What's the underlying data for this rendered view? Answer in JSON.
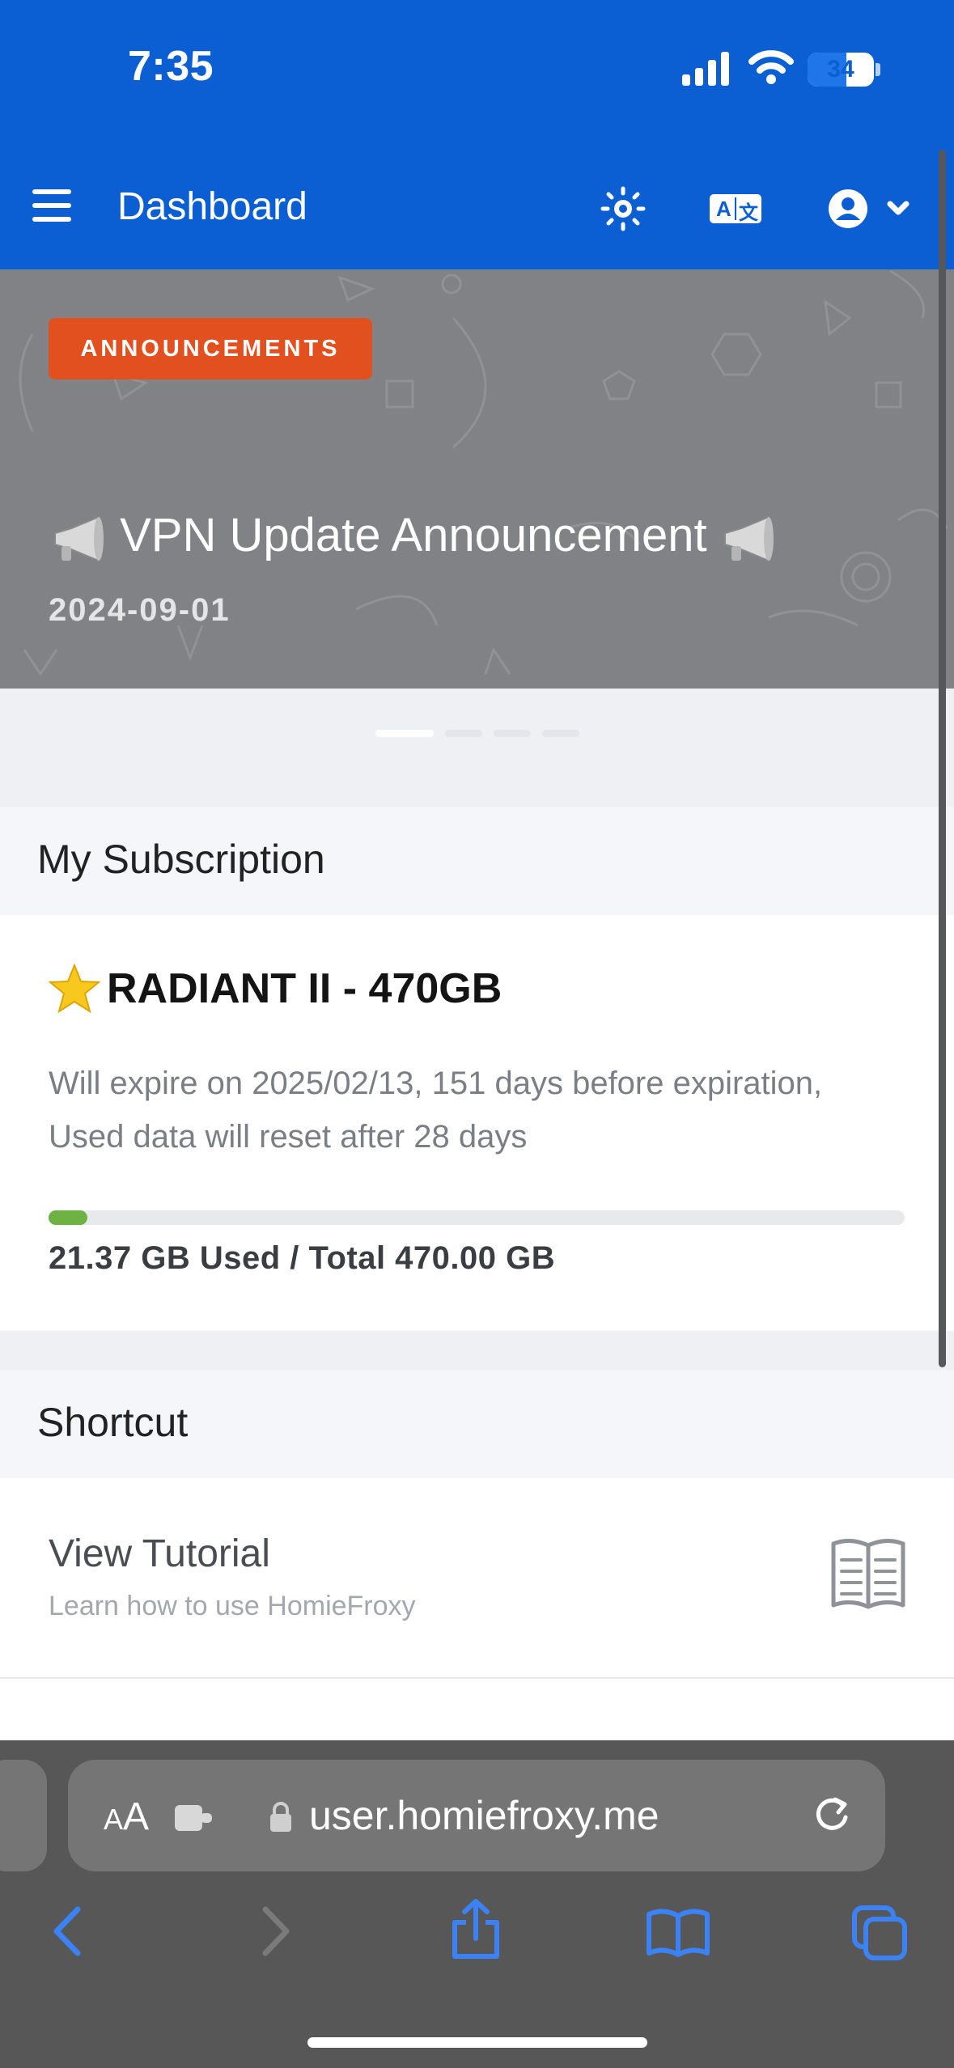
{
  "status_bar": {
    "time": "7:35",
    "battery": "34"
  },
  "header": {
    "title": "Dashboard",
    "lang_a": "A",
    "lang_b": "文"
  },
  "announcement": {
    "badge": "ANNOUNCEMENTS",
    "title": "VPN Update Announcement",
    "date": "2024-09-01",
    "slide_count": 4,
    "active_slide": 0
  },
  "subscription": {
    "heading": "My Subscription",
    "plan_name": "RADIANT II - 470GB",
    "description": "Will expire on 2025/02/13, 151 days before expiration, Used data will reset after 28 days",
    "used_gb": 21.37,
    "total_gb": 470.0,
    "usage_text": "21.37 GB Used / Total 470.00 GB"
  },
  "shortcut": {
    "heading": "Shortcut",
    "items": [
      {
        "title": "View Tutorial",
        "subtitle": "Learn how to use HomieFroxy",
        "icon": "book-icon"
      }
    ]
  },
  "browser": {
    "aa_large": "A",
    "aa_small": "A",
    "url": "user.homiefroxy.me"
  },
  "colors": {
    "header": "#0b5fd3",
    "badge": "#e3501f",
    "progress": "#6db243",
    "safari_bar": "#575757",
    "toolbar_icons": "#3b82f6"
  }
}
